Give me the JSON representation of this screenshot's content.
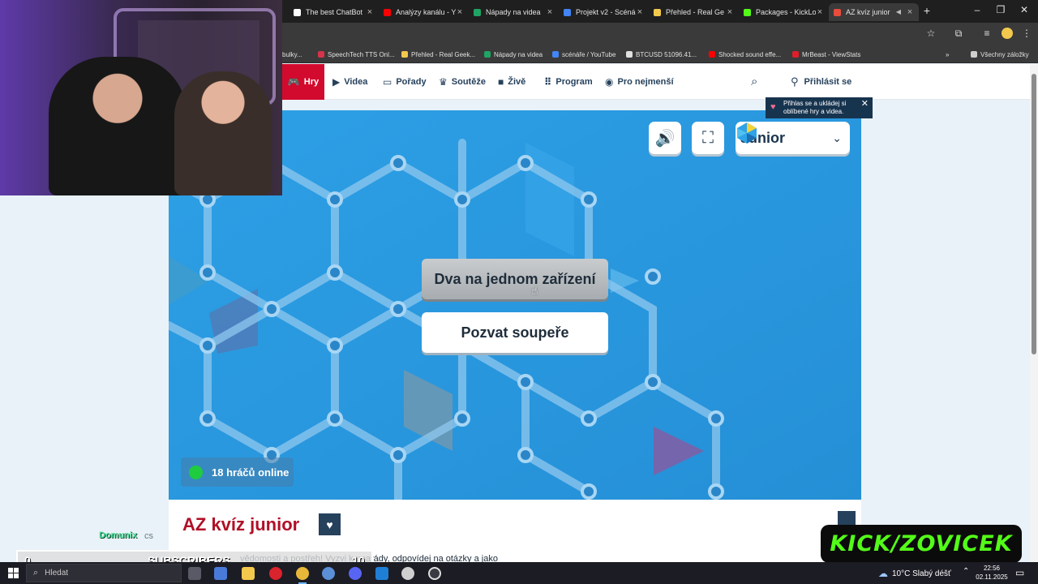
{
  "browser": {
    "tabs": [
      {
        "title": "The best ChatBot",
        "color": "#ffffff"
      },
      {
        "title": "Analýzy kanálu - Y",
        "color": "#ff0000"
      },
      {
        "title": "Nápady na videa",
        "color": "#1fa463"
      },
      {
        "title": "Projekt v2 - Scéná",
        "color": "#4285f4"
      },
      {
        "title": "Přehled - Real Ge",
        "color": "#f2c94c"
      },
      {
        "title": "Packages - KickLo",
        "color": "#53fc18"
      },
      {
        "title": "AZ kvíz junior",
        "color": "#e74c3c"
      }
    ],
    "bookmarks": [
      {
        "label": "bulky...",
        "color": "#777777"
      },
      {
        "label": "SpeechTech TTS Onl...",
        "color": "#d6334b"
      },
      {
        "label": "Přehled - Real Geek...",
        "color": "#f2c94c"
      },
      {
        "label": "Nápady na videa",
        "color": "#1fa463"
      },
      {
        "label": "scénáře / YouTube",
        "color": "#4285f4"
      },
      {
        "label": "BTCUSD 51096.41...",
        "color": "#111111"
      },
      {
        "label": "Shocked sound effe...",
        "color": "#ff0000"
      },
      {
        "label": "MrBeast - ViewStats",
        "color": "#e01e2b"
      }
    ],
    "all_bookmarks": "Všechny záložky"
  },
  "site": {
    "nav": {
      "active": "Hry",
      "items": [
        "Videa",
        "Pořady",
        "Soutěže",
        "Živě",
        "Program",
        "Pro nejmenší"
      ],
      "login": "Přihlásit se"
    },
    "tooltip": "Přihlas se a ukládej si oblíbené hry a videa.",
    "game": {
      "level": "Junior",
      "btn_two": "Dva na jednom zařízení",
      "btn_invite": "Pozvat soupeře",
      "online": "18 hráčů online"
    },
    "title": "AZ kvíz junior",
    "description": "vědomosti a postřeh! Vyzvi kamarády, odpovídej na otázky a jako"
  },
  "overlay": {
    "kick": "KICK/ZOVICEK",
    "subs": {
      "min": "0",
      "label": "SUBSCRIBERS",
      "max": "10",
      "current": 0
    },
    "alert_name": "Domunix",
    "alert_sub": "cs"
  },
  "taskbar": {
    "search": "Hledat",
    "weather": "10°C  Slabý déšť",
    "time": "22:56",
    "date": "02.11.2025",
    "notifications": "3"
  },
  "colors": {
    "accent": "#d20a2e",
    "game_bg": "#2f9de3",
    "kick_green": "#53fc18"
  }
}
